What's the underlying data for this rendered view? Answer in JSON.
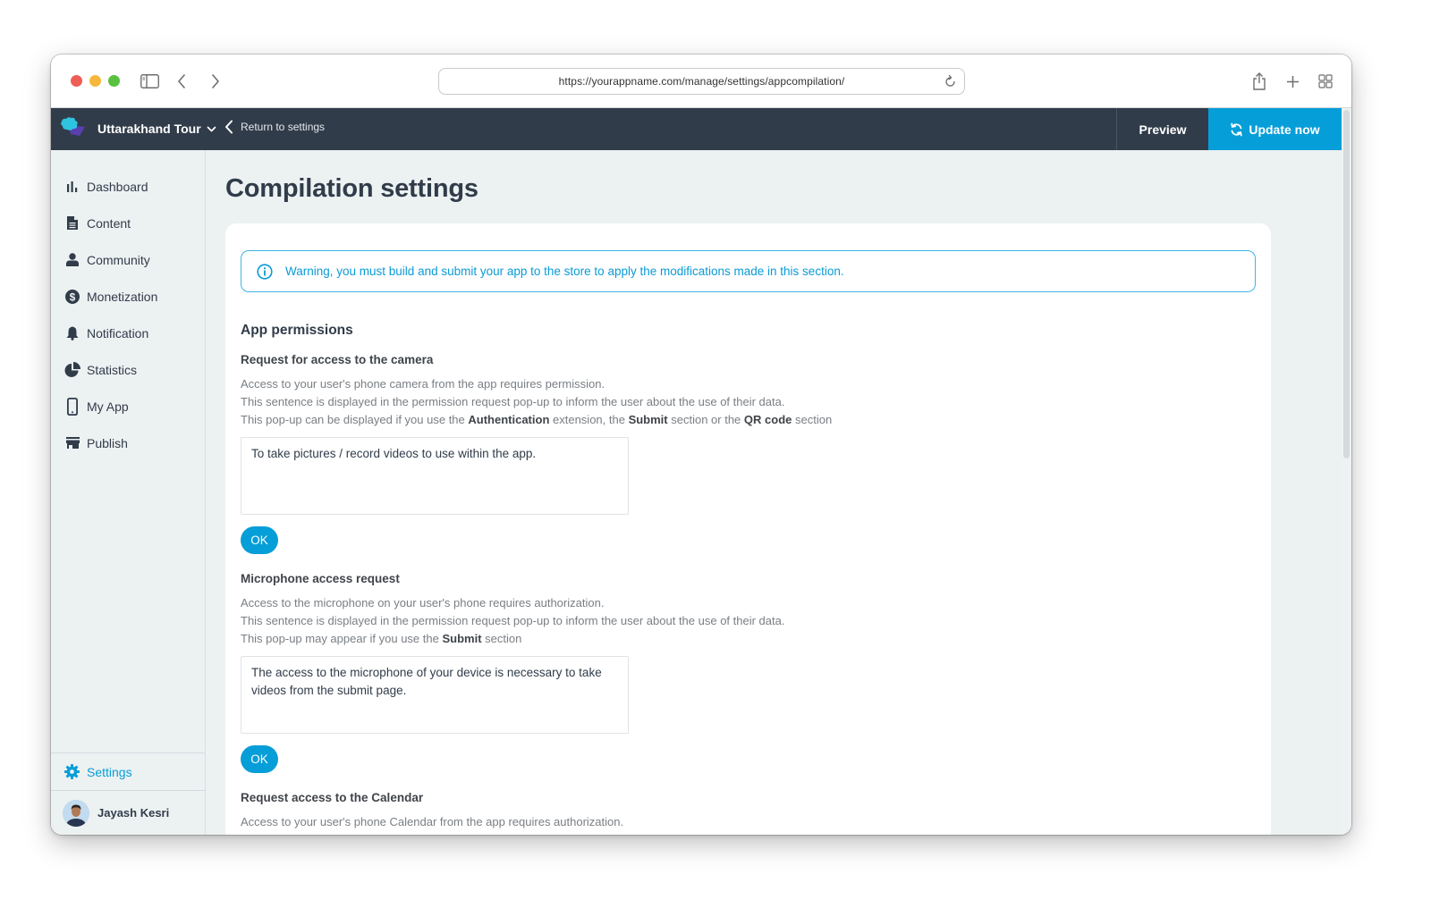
{
  "browser": {
    "url": "https://yourappname.com/manage/settings/appcompilation/"
  },
  "appbar": {
    "app_name": "Uttarakhand Tour",
    "return_label": "Return to settings",
    "preview_label": "Preview",
    "update_label": "Update now",
    "accent_color": "#069ed8",
    "bar_color": "#313c4a"
  },
  "sidebar": {
    "items": [
      {
        "label": "Dashboard",
        "icon": "bar-chart-icon"
      },
      {
        "label": "Content",
        "icon": "document-icon"
      },
      {
        "label": "Community",
        "icon": "user-icon"
      },
      {
        "label": "Monetization",
        "icon": "dollar-icon"
      },
      {
        "label": "Notification",
        "icon": "bell-icon"
      },
      {
        "label": "Statistics",
        "icon": "pie-chart-icon"
      },
      {
        "label": "My App",
        "icon": "smartphone-icon"
      },
      {
        "label": "Publish",
        "icon": "store-icon"
      }
    ],
    "settings_label": "Settings",
    "user_name": "Jayash Kesri"
  },
  "main": {
    "title": "Compilation settings",
    "alert": "Warning, you must build and submit your app to the store to apply the modifications made in this section.",
    "section_title": "App permissions",
    "permissions": [
      {
        "title": "Request for access to the camera",
        "desc_line1": "Access to your user's phone camera from the app requires permission.",
        "desc_line2": "This sentence is displayed in the permission request pop-up to inform the user about the use of their data.",
        "desc_line3_parts": [
          "This pop-up can be displayed if you use the ",
          "Authentication",
          " extension, the ",
          "Submit",
          " section or the ",
          "QR code",
          " section"
        ],
        "value": "To take pictures / record videos to use within the app.",
        "ok_label": "OK"
      },
      {
        "title": "Microphone access request",
        "desc_line1": "Access to the microphone on your user's phone requires authorization.",
        "desc_line2": "This sentence is displayed in the permission request pop-up to inform the user about the use of their data.",
        "desc_line3_parts": [
          "This pop-up may appear if you use the ",
          "Submit",
          " section"
        ],
        "value": "The access to the microphone of your device is necessary to take videos from the submit page.",
        "ok_label": "OK"
      },
      {
        "title": "Request access to the Calendar",
        "desc_line1": "Access to your user's phone Calendar from the app requires authorization."
      }
    ]
  }
}
